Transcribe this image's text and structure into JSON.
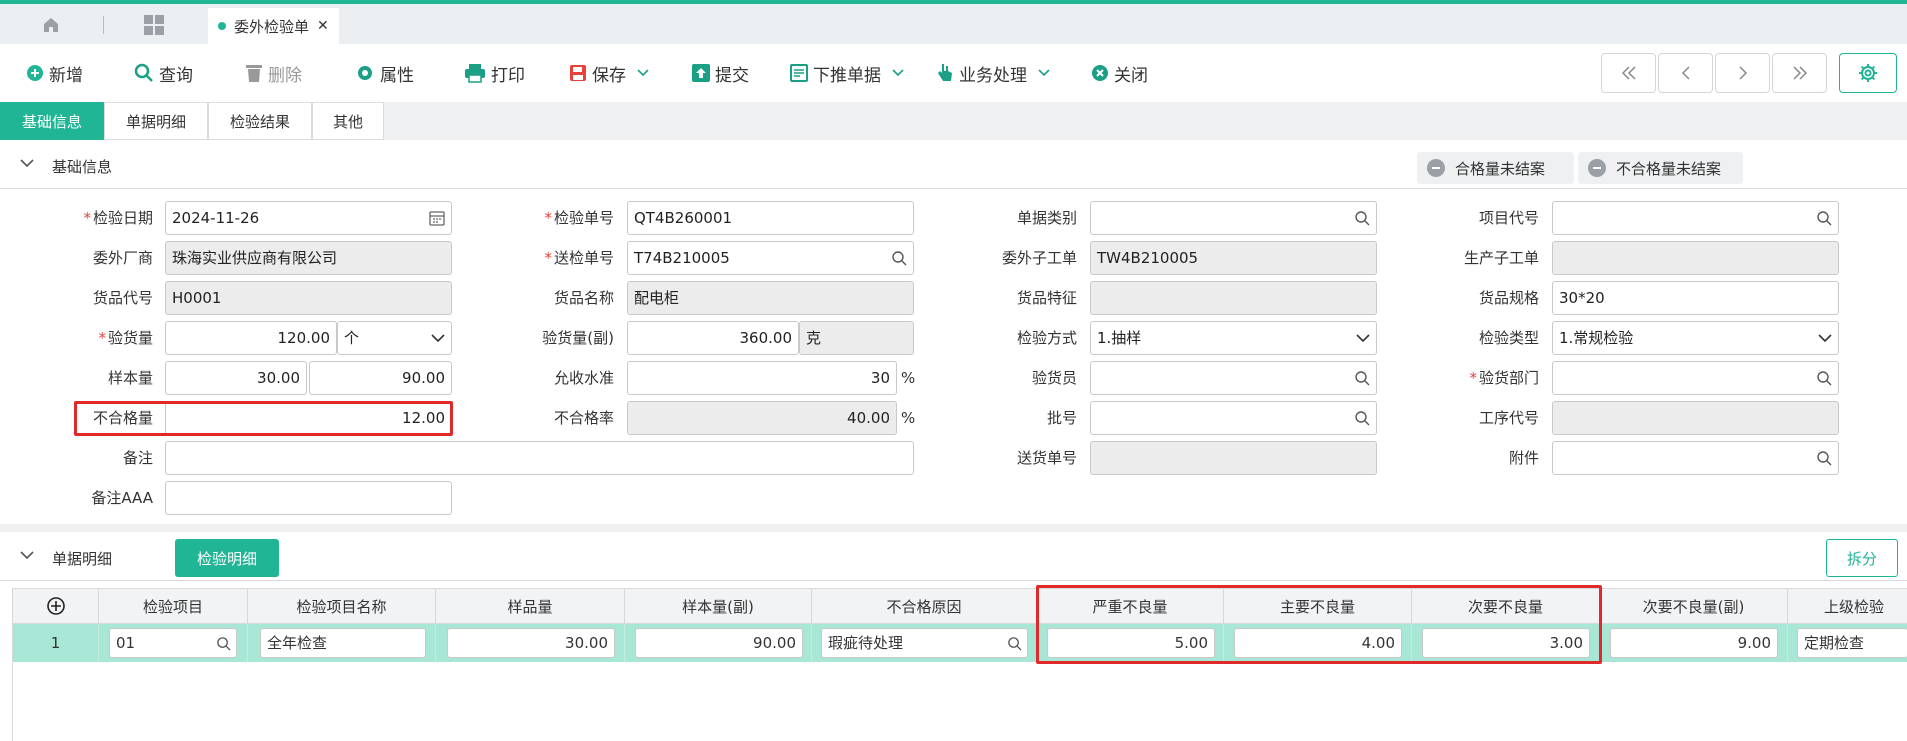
{
  "tabs": {
    "document_tab": "委外检验单",
    "close_glyph": "✕"
  },
  "toolbar": {
    "add": "新增",
    "query": "查询",
    "delete": "删除",
    "props": "属性",
    "print": "打印",
    "save": "保存",
    "submit": "提交",
    "push_down": "下推单据",
    "business": "业务处理",
    "close": "关闭"
  },
  "section_tabs": [
    "基础信息",
    "单据明细",
    "检验结果",
    "其他"
  ],
  "basic_section": {
    "title": "基础信息",
    "qualified_status": "合格量未结案",
    "unqualified_status": "不合格量未结案"
  },
  "form": {
    "inspect_date": {
      "label": "检验日期",
      "value": "2024-11-26"
    },
    "supplier": {
      "label": "委外厂商",
      "value": "珠海实业供应商有限公司"
    },
    "item_code": {
      "label": "货品代号",
      "value": "H0001"
    },
    "check_qty": {
      "label": "验货量",
      "value": "120.00",
      "unit": "个"
    },
    "sample_qty": {
      "label": "样本量",
      "value": "30.00",
      "value2": "90.00"
    },
    "unqualified_qty": {
      "label": "不合格量",
      "value": "12.00"
    },
    "remark": {
      "label": "备注",
      "value": ""
    },
    "remark_aaa": {
      "label": "备注AAA",
      "value": ""
    },
    "inspect_no": {
      "label": "检验单号",
      "value": "QT4B260001"
    },
    "delivery_no": {
      "label": "送检单号",
      "value": "T74B210005"
    },
    "item_name": {
      "label": "货品名称",
      "value": "配电柜"
    },
    "check_qty2": {
      "label": "验货量(副)",
      "value": "360.00",
      "unit": "克"
    },
    "accept_level": {
      "label": "允收水准",
      "value": "30",
      "pct": "%"
    },
    "unqualified_rate": {
      "label": "不合格率",
      "value": "40.00",
      "pct": "%"
    },
    "doc_type": {
      "label": "单据类别",
      "value": ""
    },
    "sub_order": {
      "label": "委外子工单",
      "value": "TW4B210005"
    },
    "item_feature": {
      "label": "货品特征",
      "value": ""
    },
    "inspect_method": {
      "label": "检验方式",
      "value": "1.抽样"
    },
    "inspector": {
      "label": "验货员",
      "value": ""
    },
    "batch_no": {
      "label": "批号",
      "value": ""
    },
    "ship_no": {
      "label": "送货单号",
      "value": ""
    },
    "project_code": {
      "label": "项目代号",
      "value": ""
    },
    "prod_sub_order": {
      "label": "生产子工单",
      "value": ""
    },
    "item_spec": {
      "label": "货品规格",
      "value": "30*20"
    },
    "inspect_type": {
      "label": "检验类型",
      "value": "1.常规检验"
    },
    "inspect_dept": {
      "label": "验货部门",
      "value": ""
    },
    "process_code": {
      "label": "工序代号",
      "value": ""
    },
    "attachment": {
      "label": "附件",
      "value": ""
    }
  },
  "detail_section": {
    "title": "单据明细",
    "tab": "检验明细",
    "split": "拆分"
  },
  "grid": {
    "columns": [
      "检验项目",
      "检验项目名称",
      "样品量",
      "样本量(副)",
      "不合格原因",
      "严重不良量",
      "主要不良量",
      "次要不良量",
      "次要不良量(副)",
      "上级检验"
    ],
    "rows": [
      {
        "no": "1",
        "item": "01",
        "name": "全年检查",
        "sample": "30.00",
        "sample2": "90.00",
        "reason": "瑕疵待处理",
        "critical": "5.00",
        "major": "4.00",
        "minor": "3.00",
        "minor2": "9.00",
        "parent": "定期检查"
      }
    ]
  }
}
